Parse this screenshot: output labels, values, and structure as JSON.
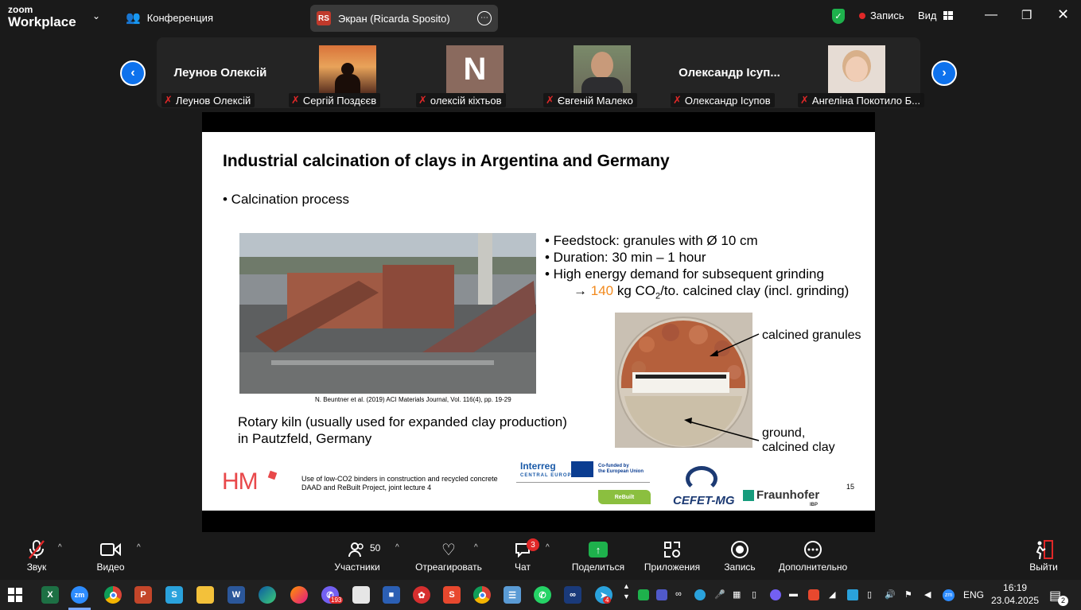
{
  "titlebar": {
    "logo_top": "zoom",
    "logo_bottom": "Workplace",
    "conference_label": "Конференция",
    "share_badge": "RS",
    "share_title": "Экран (Ricarda Sposito)",
    "record_label": "Запись",
    "view_label": "Вид"
  },
  "participants": [
    {
      "big_name": "Леунов Олексій",
      "label": "Леунов Олексій",
      "type": "name"
    },
    {
      "big_name": "",
      "label": "Сергій Поздєєв",
      "type": "photo-sunset"
    },
    {
      "big_name": "N",
      "label": "олексій кіхтьов",
      "type": "letter"
    },
    {
      "big_name": "",
      "label": "Євгеній Малеко",
      "type": "photo-man"
    },
    {
      "big_name": "Олександр Ісуп...",
      "label": "Олександр Ісупов",
      "type": "name"
    },
    {
      "big_name": "",
      "label": "Ангеліна Покотило Б...",
      "type": "photo-woman"
    }
  ],
  "slide": {
    "title": "Industrial calcination of clays in Argentina and Germany",
    "subtitle": "• Calcination process",
    "bullets": [
      "•  Feedstock: granules with Ø 10 cm",
      "•  Duration: 30 min – 1 hour",
      "•  High energy demand for subsequent grinding"
    ],
    "arrow_prefix": "→ ",
    "arrow_value": "140",
    "arrow_mid": " kg CO",
    "arrow_sub": "2",
    "arrow_suffix": "/to. calcined clay (incl. grinding)",
    "citation": "N. Beuntner et al. (2019) ACI Materials Journal, Vol. 116(4), pp. 19-29",
    "caption_line1": "Rotary kiln (usually used for expanded clay production)",
    "caption_line2": "in Pautzfeld, Germany",
    "label_granules": "calcined granules",
    "label_ground_1": "ground,",
    "label_ground_2": "calcined clay",
    "logo_hm": "HM",
    "footer_line1": "Use of low-CO2 binders in construction and recycled concrete",
    "footer_line2": "DAAD and ReBuilt Project, joint lecture 4",
    "interreg": "Interreg",
    "interreg_sub": "CENTRAL EUROPE",
    "cofund_1": "Co-funded by",
    "cofund_2": "the European Union",
    "rebuilt": "ReBuilt",
    "cefet": "CEFET-MG",
    "fraunhofer": "Fraunhofer",
    "ibp": "IBP",
    "page_number": "15"
  },
  "toolbar": {
    "audio": "Звук",
    "video": "Видео",
    "participants": "Участники",
    "participants_count": "50",
    "react": "Отреагировать",
    "chat": "Чат",
    "chat_badge": "3",
    "share": "Поделиться",
    "apps": "Приложения",
    "record": "Запись",
    "more": "Дополнительно",
    "leave": "Выйти"
  },
  "taskbar": {
    "language": "ENG",
    "time": "16:19",
    "date": "23.04.2025",
    "notif_count": "2",
    "viber_badge": "193",
    "telegram_badge": "4"
  },
  "colors": {
    "accent_blue": "#0e72ed",
    "green": "#1eb14c",
    "red": "#e02828",
    "orange_highlight": "#f28a1e",
    "hm_red": "#e8484a"
  }
}
